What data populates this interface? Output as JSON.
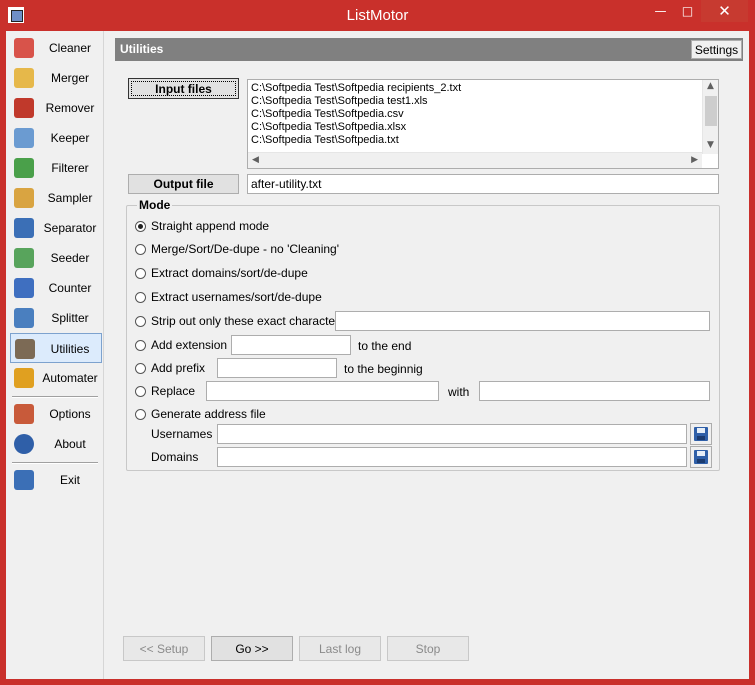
{
  "window": {
    "title": "ListMotor",
    "minimize_glyph": "—",
    "maximize_glyph": "□",
    "close_glyph": "✕"
  },
  "sidebar": {
    "items": [
      {
        "label": "Cleaner",
        "icon": "eraser-icon",
        "color": "#d8534a"
      },
      {
        "label": "Merger",
        "icon": "merge-icon",
        "color": "#e6b84a"
      },
      {
        "label": "Remover",
        "icon": "remove-icon",
        "color": "#c0392b"
      },
      {
        "label": "Keeper",
        "icon": "funnel-icon",
        "color": "#6b9bd1"
      },
      {
        "label": "Filterer",
        "icon": "filter-icon",
        "color": "#4aa04a"
      },
      {
        "label": "Sampler",
        "icon": "sampler-icon",
        "color": "#d9a441"
      },
      {
        "label": "Separator",
        "icon": "grid-icon",
        "color": "#3b6fb6"
      },
      {
        "label": "Seeder",
        "icon": "seeder-icon",
        "color": "#58a45c"
      },
      {
        "label": "Counter",
        "icon": "counter-icon",
        "color": "#3f6fc0"
      },
      {
        "label": "Splitter",
        "icon": "splitter-icon",
        "color": "#4a7fbf"
      },
      {
        "label": "Utilities",
        "icon": "hammer-icon",
        "color": "#7c6a55"
      },
      {
        "label": "Automater",
        "icon": "automater-icon",
        "color": "#e0a020"
      }
    ],
    "secondary": [
      {
        "label": "Options",
        "icon": "options-icon",
        "color": "#c85a3a"
      },
      {
        "label": "About",
        "icon": "help-icon",
        "color": "#2f5fa8"
      }
    ],
    "exit": {
      "label": "Exit",
      "icon": "exit-door-icon",
      "color": "#3b6fb6"
    },
    "active": "Utilities"
  },
  "header": {
    "title": "Utilities",
    "settings_label": "Settings",
    "bar_color": "#808080"
  },
  "input": {
    "button_label": "Input files",
    "files": [
      "C:\\Softpedia Test\\Softpedia recipients_2.txt",
      "C:\\Softpedia Test\\Softpedia test1.xls",
      "C:\\Softpedia Test\\Softpedia.csv",
      "C:\\Softpedia Test\\Softpedia.xlsx",
      "C:\\Softpedia Test\\Softpedia.txt"
    ]
  },
  "output": {
    "button_label": "Output file",
    "value": "after-utility.txt"
  },
  "mode": {
    "group_title": "Mode",
    "options": {
      "straight": "Straight append mode",
      "merge": "Merge/Sort/De-dupe - no 'Cleaning'",
      "domains": "Extract domains/sort/de-dupe",
      "usernames": "Extract usernames/sort/de-dupe",
      "strip": "Strip out only these exact characters",
      "extension": "Add extension",
      "prefix": "Add prefix",
      "replace": "Replace",
      "generate": "Generate address file"
    },
    "selected": "straight",
    "extension_suffix": "to the end",
    "prefix_suffix": "to the beginnig",
    "with_label": "with",
    "usernames_label": "Usernames",
    "domains_label": "Domains"
  },
  "footer": {
    "setup": "<< Setup",
    "go": "Go >>",
    "last_log": "Last log",
    "stop": "Stop"
  }
}
